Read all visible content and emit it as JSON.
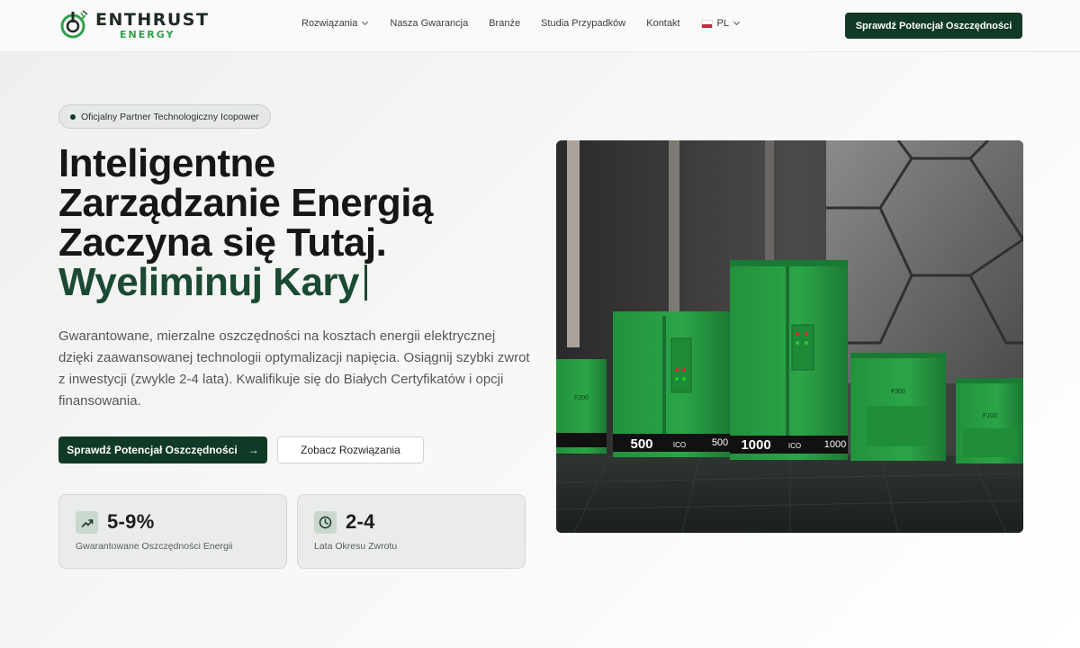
{
  "brand": {
    "name_line1": "ENTHRUST",
    "name_line2": "ENERGY",
    "accent": "#2fa14a",
    "dark": "#103a25"
  },
  "nav": {
    "items": [
      {
        "label": "Rozwiązania",
        "has_dropdown": true
      },
      {
        "label": "Nasza Gwarancja"
      },
      {
        "label": "Branże"
      },
      {
        "label": "Studia Przypadków"
      },
      {
        "label": "Kontakt"
      }
    ],
    "language": {
      "label": "PL",
      "flag": "poland-flag-icon"
    },
    "cta_label": "Sprawdź Potencjał Oszczędności"
  },
  "hero": {
    "badge": "Oficjalny Partner Technologiczny Icopower",
    "headline_lines": [
      "Inteligentne",
      "Zarządzanie Energią",
      "Zaczyna się Tutaj."
    ],
    "headline_accent": "Wyeliminuj Kary",
    "description": "Gwarantowane, mierzalne oszczędności na kosztach energii elektrycznej dzięki zaawansowanej technologii optymalizacji napięcia. Osiągnij szybki zwrot z inwestycji (zwykle 2-4 lata). Kwalifikuje się do Białych Certyfikatów i opcji finansowania.",
    "primary_button": "Sprawdź Potencjał Oszczędności",
    "secondary_button": "Zobacz Rozwiązania"
  },
  "stats": [
    {
      "icon": "trending-up-icon",
      "value": "5-9%",
      "label": "Gwarantowane Oszczędności Energii"
    },
    {
      "icon": "clock-icon",
      "value": "2-4",
      "label": "Lata Okresu Zwrotu"
    }
  ],
  "product_image": {
    "unit_labels": [
      "500",
      "1000"
    ],
    "brand_mark": "ICO",
    "models": [
      "F200",
      "F300",
      "F100"
    ]
  }
}
